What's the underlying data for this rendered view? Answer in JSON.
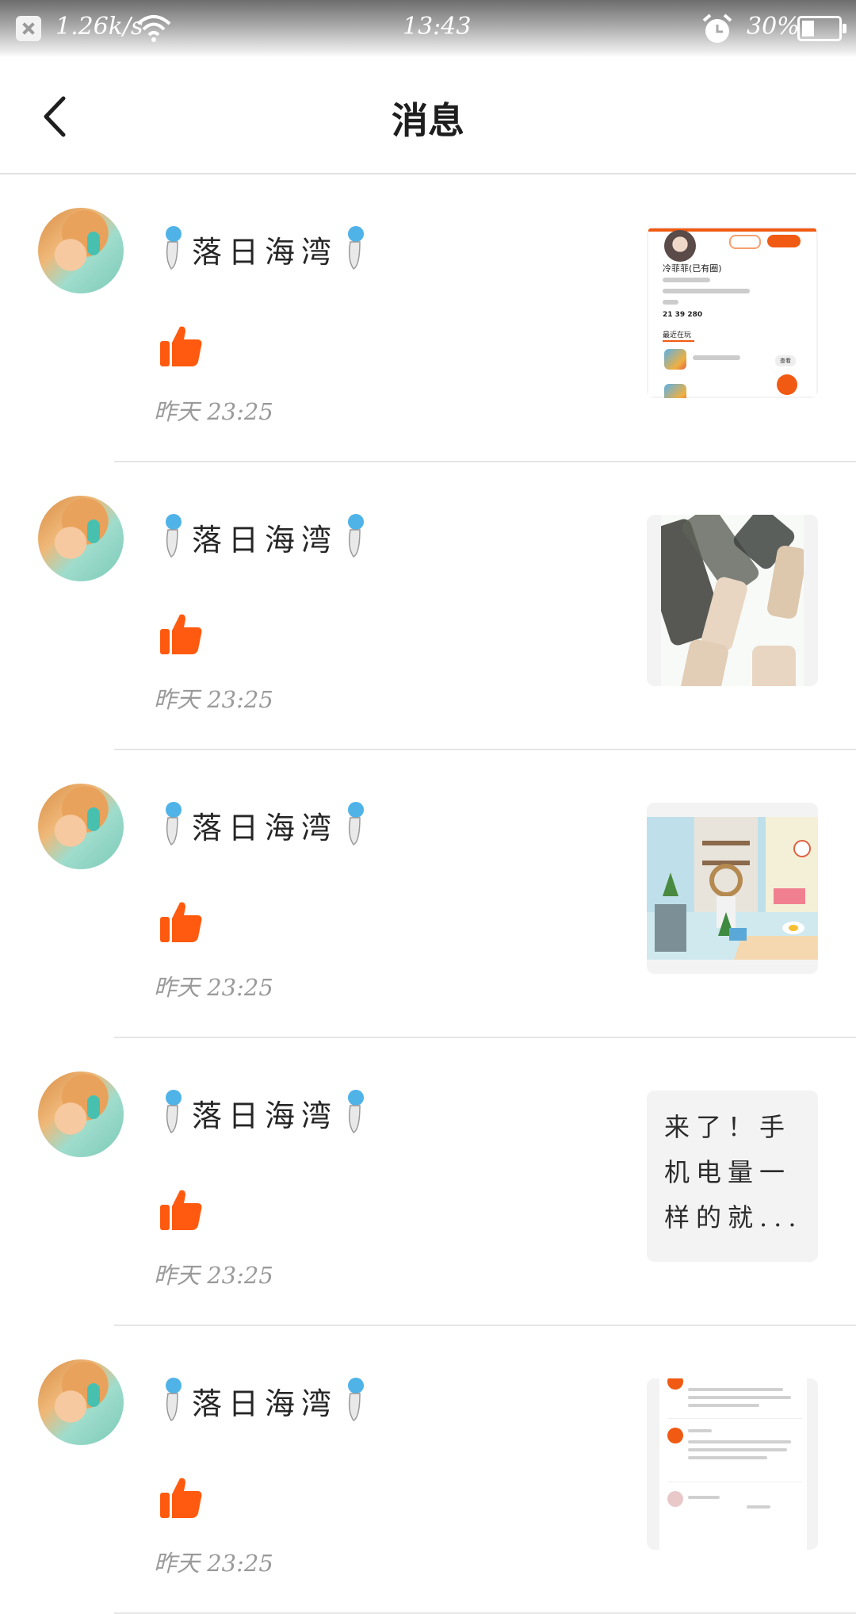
{
  "status_bar": {
    "net_speed": "1.26k/s",
    "time": "13:43",
    "battery": "30%",
    "battery_level": 0.3,
    "icons": [
      "close-notification-icon",
      "wifi-icon",
      "alarm-clock-icon",
      "battery-icon"
    ]
  },
  "header": {
    "title": "消息",
    "back_icon": "chevron-left-icon"
  },
  "colors": {
    "accent": "#f05a12",
    "like": "#ff5a0f",
    "timestamp": "#9a9a9a",
    "divider": "#e6e6e6"
  },
  "messages": [
    {
      "username": "落日海湾",
      "action_icon": "thumbs-up-icon",
      "time": "昨天 23:25",
      "thumb_type": "profile-screenshot",
      "thumb": {
        "name": "冷菲菲(已有圈)",
        "stats": "21    39    280",
        "tab": "最近在玩",
        "check": "查看"
      }
    },
    {
      "username": "落日海湾",
      "action_icon": "thumbs-up-icon",
      "time": "昨天 23:25",
      "thumb_type": "brush-strokes-image"
    },
    {
      "username": "落日海湾",
      "action_icon": "thumbs-up-icon",
      "time": "昨天 23:25",
      "thumb_type": "room-scene-image"
    },
    {
      "username": "落日海湾",
      "action_icon": "thumbs-up-icon",
      "time": "昨天 23:25",
      "thumb_type": "text",
      "thumb_text": "来了！手机电量一样的就..."
    },
    {
      "username": "落日海湾",
      "action_icon": "thumbs-up-icon",
      "time": "昨天 23:25",
      "thumb_type": "comments-screenshot"
    }
  ]
}
